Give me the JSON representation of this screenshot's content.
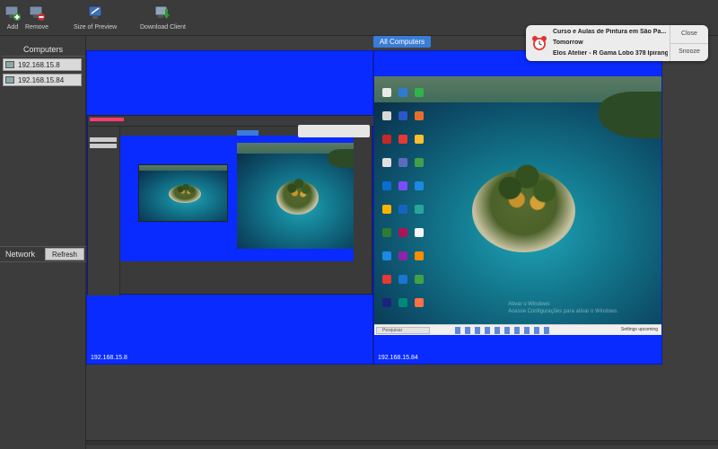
{
  "toolbar": {
    "add_label": "Add",
    "remove_label": "Remove",
    "size_label": "Size of Preview",
    "download_label": "Download Client"
  },
  "sidebar": {
    "title": "Computers",
    "computers": [
      "192.168.15.8",
      "192.168.15.84"
    ],
    "network_label": "Network",
    "refresh_label": "Refresh"
  },
  "main": {
    "tab_label": "All Computers",
    "panels": [
      {
        "label": "192.168.15.8"
      },
      {
        "label": "192.168.15.84"
      }
    ],
    "taskbar_search": "Pesquisar",
    "taskbar_tray": "Settings upcoming",
    "watermark_line1": "Ativar o Windows",
    "watermark_line2": "Acesse Configurações para ativar o Windows."
  },
  "notification": {
    "title": "Curso e Aulas de Pintura em São Pa...",
    "subtitle": "Tomorrow",
    "body": "Elos Atelier - R Gama Lobo 378 Ipirang...",
    "close_label": "Close",
    "snooze_label": "Snooze"
  },
  "colors": {
    "panel_blue": "#0a2bff",
    "tab_blue": "#3a7cd8"
  }
}
